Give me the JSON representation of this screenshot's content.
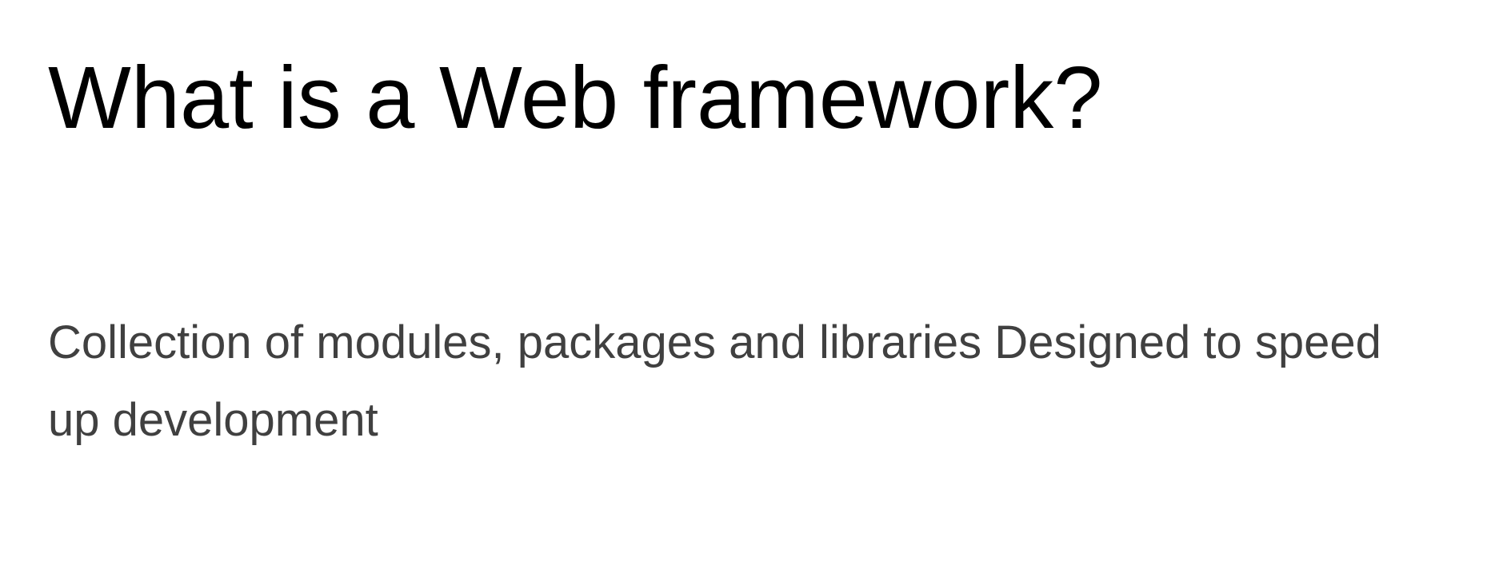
{
  "slide": {
    "title": "What is a Web framework?",
    "body": "Collection of modules, packages and libraries Designed to speed up development"
  },
  "colors": {
    "background": "#ffffff",
    "title": "#000000",
    "body": "#404040"
  }
}
